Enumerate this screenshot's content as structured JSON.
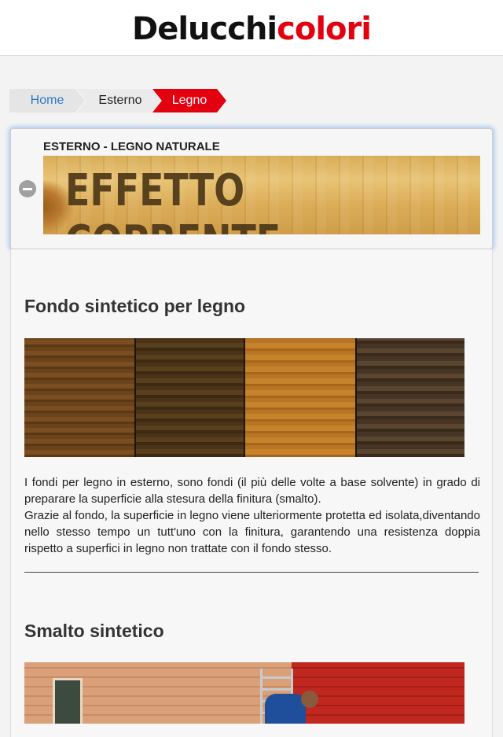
{
  "header": {
    "logo_part1": "Delucchi",
    "logo_part2": "colori"
  },
  "breadcrumb": {
    "home": "Home",
    "level2": "Esterno",
    "current": "Legno"
  },
  "panel": {
    "title": "ESTERNO - LEGNO NATURALE",
    "banner_text": "EFFETTO COPRENTE"
  },
  "section1": {
    "title": "Fondo sintetico per legno",
    "paragraph1": "I fondi per legno in esterno, sono fondi (il più delle volte a base solvente) in grado di preparare la superficie alla stesura della finitura (smalto).",
    "paragraph2": "Grazie al fondo, la superficie in legno viene ulteriormente protetta ed isolata,diventando nello stesso tempo un tutt'uno con la finitura, garantendo una resistenza doppia rispetto a superfici in legno non trattate con il fondo stesso."
  },
  "section2": {
    "title": "Smalto sintetico"
  },
  "colors": {
    "brand_red": "#e3000f",
    "link_blue": "#2b78c7"
  }
}
